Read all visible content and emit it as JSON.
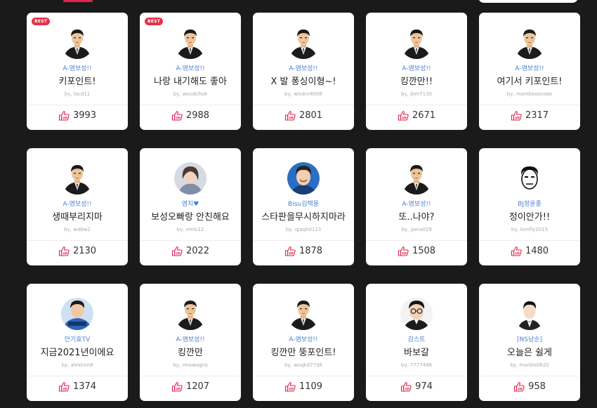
{
  "accent_color": "#e0224f",
  "link_color": "#4a7fd4",
  "cards": [
    {
      "badge": "BEST",
      "avatar": "man-suit-avatar",
      "streamer": "A-염보성!!",
      "title": "키포인트!",
      "author": "by, lacd11",
      "votes": "3993"
    },
    {
      "badge": "BEST",
      "avatar": "man-suit-avatar",
      "streamer": "A-염보성!!",
      "title": "나랑 내기해도 좋아",
      "author": "by, woodchok",
      "votes": "2988"
    },
    {
      "badge": "",
      "avatar": "man-suit-avatar",
      "streamer": "A-염보성!!",
      "title": "X 발 퐁싱이형~!",
      "author": "by, wlsdnr8006",
      "votes": "2801"
    },
    {
      "badge": "",
      "avatar": "man-suit-avatar",
      "streamer": "A-염보성!!",
      "title": "킹깐만!!",
      "author": "by, jbm7130",
      "votes": "2671"
    },
    {
      "badge": "",
      "avatar": "man-suit-avatar",
      "streamer": "A-염보성!!",
      "title": "여기서 키포인트!",
      "author": "by, mamboosnake",
      "votes": "2317"
    },
    {
      "badge": "",
      "avatar": "man-suit-avatar",
      "streamer": "A-염보성!!",
      "title": "생때부리지마",
      "author": "by, wdbw2",
      "votes": "2130"
    },
    {
      "badge": "",
      "avatar": "woman-photo-avatar",
      "streamer": "엠지♥",
      "title": "보성오빠랑 안친해요",
      "author": "by, emls12",
      "votes": "2022"
    },
    {
      "badge": "",
      "avatar": "smiling-man-photo-avatar",
      "streamer": "Bisu김택용",
      "title": "스타판을무시하지마라",
      "author": "by, qjaqhd123",
      "votes": "1878"
    },
    {
      "badge": "",
      "avatar": "man-suit-avatar",
      "streamer": "A-염보성!!",
      "title": "또..나야?",
      "author": "by, jjana029",
      "votes": "1508"
    },
    {
      "badge": "",
      "avatar": "sketch-face-avatar",
      "streamer": "BJ정윤종",
      "title": "정이안가!!",
      "author": "by, kimfly2015",
      "votes": "1480"
    },
    {
      "badge": "",
      "avatar": "blue-shirt-man-avatar",
      "streamer": "안기효TV",
      "title": "지금2021년이에요",
      "author": "by, alexkim8",
      "votes": "1374"
    },
    {
      "badge": "",
      "avatar": "man-suit-avatar",
      "streamer": "A-염보성!!",
      "title": "킹깐만",
      "author": "by, rmawogns",
      "votes": "1207"
    },
    {
      "badge": "",
      "avatar": "man-suit-avatar",
      "streamer": "A-염보성!!",
      "title": "킹깐만 뚱포인트!",
      "author": "by, woqkd7736",
      "votes": "1109"
    },
    {
      "badge": "",
      "avatar": "glasses-man-avatar",
      "streamer": "감스트",
      "title": "바보갈",
      "author": "by, 7777486",
      "votes": "974"
    },
    {
      "badge": "",
      "avatar": "tuxedo-man-avatar",
      "streamer": "[NS남순]",
      "title": "오늘은 쉴게",
      "author": "by, marble0620",
      "votes": "958"
    }
  ]
}
